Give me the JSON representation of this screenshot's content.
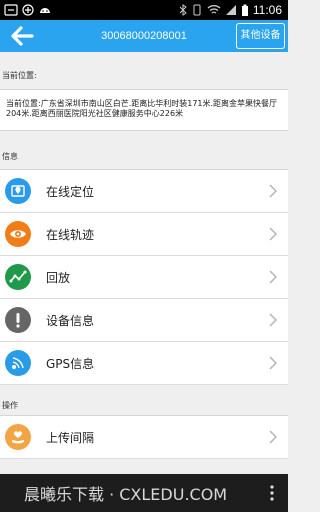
{
  "statusbar": {
    "time": "11:06"
  },
  "header": {
    "device_id": "30068000208001",
    "other_devices_label": "其他设备"
  },
  "location": {
    "section_label": "当前位置:",
    "text": "当前位置:广东省深圳市南山区白芒.距离比华利时装171米.距离金苹果快餐厅204米.距离西丽医院阳光社区健康服务中心226米"
  },
  "info": {
    "section_label": "信息",
    "items": [
      {
        "label": "在线定位",
        "icon": "map-pin-icon",
        "color": "#2a9be8"
      },
      {
        "label": "在线轨迹",
        "icon": "eye-icon",
        "color": "#f07d18"
      },
      {
        "label": "回放",
        "icon": "trend-chart-icon",
        "color": "#1f9a4a"
      },
      {
        "label": "设备信息",
        "icon": "exclamation-icon",
        "color": "#666666"
      },
      {
        "label": "GPS信息",
        "icon": "satellite-icon",
        "color": "#2a9be8"
      }
    ]
  },
  "operations": {
    "section_label": "操作",
    "items": [
      {
        "label": "上传间隔",
        "icon": "heart-hand-icon",
        "color": "#f2a545"
      }
    ]
  },
  "watermark": {
    "text": "晨曦乐下载 · CXLEDU.COM"
  },
  "colors": {
    "accent": "#2aa4ee",
    "background": "#efefef"
  }
}
